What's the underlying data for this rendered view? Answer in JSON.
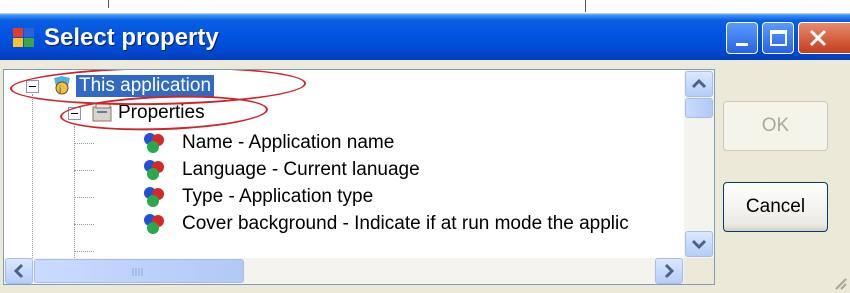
{
  "dialog": {
    "title": "Select property",
    "buttons": {
      "ok": "OK",
      "cancel": "Cancel"
    }
  },
  "tree": {
    "root": {
      "label": "This application"
    },
    "group": {
      "label": "Properties"
    },
    "items": [
      {
        "label": "Name - Application name"
      },
      {
        "label": "Language - Current lanuage"
      },
      {
        "label": "Type - Application type"
      },
      {
        "label": "Cover background - Indicate if at run mode the applic"
      }
    ]
  },
  "colors": {
    "selection": "#316ac5",
    "annotation": "#d0262a",
    "titlebar": "#0054e3"
  },
  "icons": [
    "app-icon",
    "minimize-icon",
    "maximize-icon",
    "close-icon",
    "application-node-icon",
    "properties-folder-icon",
    "property-item-icon",
    "scroll-up-icon",
    "scroll-down-icon",
    "scroll-left-icon",
    "scroll-right-icon"
  ]
}
